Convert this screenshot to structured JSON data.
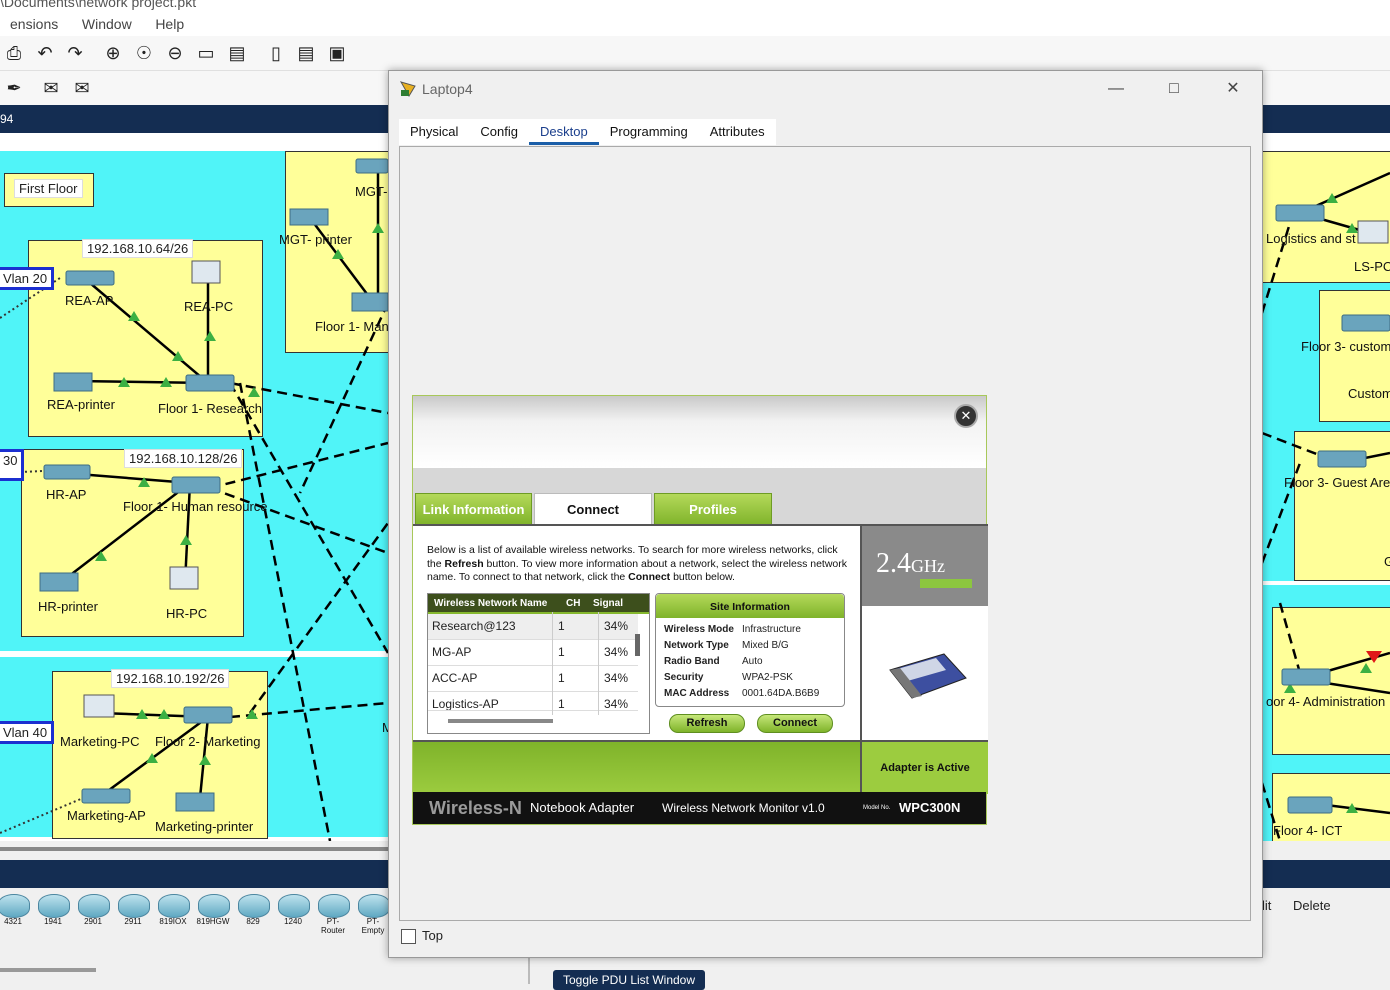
{
  "app": {
    "title_fragment": "\\Documents\\network project.pkt",
    "menu": [
      "ensions",
      "Window",
      "Help"
    ],
    "nav_fragment": "94"
  },
  "canvas": {
    "room_labels": {
      "first_floor": "First Floor",
      "subnet_64": "192.168.10.64/26",
      "subnet_128": "192.168.10.128/26",
      "subnet_192": "192.168.10.192/26"
    },
    "vlans": {
      "v20": "Vlan 20",
      "v30": "30",
      "v40": "Vlan 40"
    },
    "devices": {
      "rea_ap": "REA-AP",
      "rea_pc": "REA-PC",
      "rea_printer": "REA-printer",
      "floor1_research": "Floor 1- Research",
      "hr_ap": "HR-AP",
      "floor1_hr": "Floor 1- Human resource",
      "hr_printer": "HR-printer",
      "hr_pc": "HR-PC",
      "marketing_pc": "Marketing-PC",
      "floor2_marketing": "Floor 2- Marketing",
      "marketing_ap": "Marketing-AP",
      "marketing_printer": "Marketing-printer",
      "mgt_printer": "MGT- printer",
      "mgt_ap": "MGT-",
      "floor1_man": "Floor 1- Man",
      "logistics": "Logistics and st",
      "ls_pc": "LS-PC",
      "floor3_custom": "Floor 3- custom",
      "custom": "Custom",
      "floor3_guest": "Floor 3- Guest Are",
      "g": "G",
      "floor4_admin": "oor 4- Administration",
      "floor4_ict": "Floor 4- ICT",
      "m": "M"
    }
  },
  "device_bar": [
    "4321",
    "1941",
    "2901",
    "2911",
    "819IOX",
    "819HGW",
    "829",
    "1240",
    "PT-Router",
    "PT-Empty"
  ],
  "right_strip": {
    "lit": "lit",
    "delete": "Delete"
  },
  "pdu_button": "Toggle PDU List Window",
  "window": {
    "title": "Laptop4",
    "tabs": [
      "Physical",
      "Config",
      "Desktop",
      "Programming",
      "Attributes"
    ],
    "active_tab": "Desktop",
    "top_checkbox": "Top"
  },
  "wireless_monitor": {
    "tabs": [
      "Link Information",
      "Connect",
      "Profiles"
    ],
    "active_tab": "Connect",
    "desc_1": "Below is a list of available wireless networks. To search for more wireless networks, click the ",
    "desc_refresh": "Refresh",
    "desc_2": " button. To view more information about a network, select the wireless network name. To connect to that network, click the ",
    "desc_connect": "Connect",
    "desc_3": " button below.",
    "table_headers": {
      "name": "Wireless Network Name",
      "ch": "CH",
      "signal": "Signal"
    },
    "networks": [
      {
        "name": "Research@123",
        "ch": "1",
        "signal": "34%"
      },
      {
        "name": "MG-AP",
        "ch": "1",
        "signal": "34%"
      },
      {
        "name": "ACC-AP",
        "ch": "1",
        "signal": "34%"
      },
      {
        "name": "Logistics-AP",
        "ch": "1",
        "signal": "34%"
      }
    ],
    "site_info": {
      "title": "Site Information",
      "rows": [
        {
          "label": "Wireless Mode",
          "value": "Infrastructure"
        },
        {
          "label": "Network Type",
          "value": "Mixed B/G"
        },
        {
          "label": "Radio Band",
          "value": "Auto"
        },
        {
          "label": "Security",
          "value": "WPA2-PSK"
        },
        {
          "label": "MAC Address",
          "value": "0001.64DA.B6B9"
        }
      ]
    },
    "refresh_button": "Refresh",
    "connect_button": "Connect",
    "band_number": "2.4",
    "band_unit": "GHz",
    "adapter_status": "Adapter is Active",
    "footer": {
      "brand": "Wireless-N",
      "product": "Notebook Adapter",
      "monitor": "Wireless Network Monitor  v1.0",
      "model_prefix": "Model No.",
      "model": "WPC300N"
    }
  },
  "colors": {
    "accent_green": "#8cc63f",
    "nav_blue": "#142d52",
    "canvas_cyan": "#50f4f8",
    "room_yellow": "#ffff99"
  }
}
